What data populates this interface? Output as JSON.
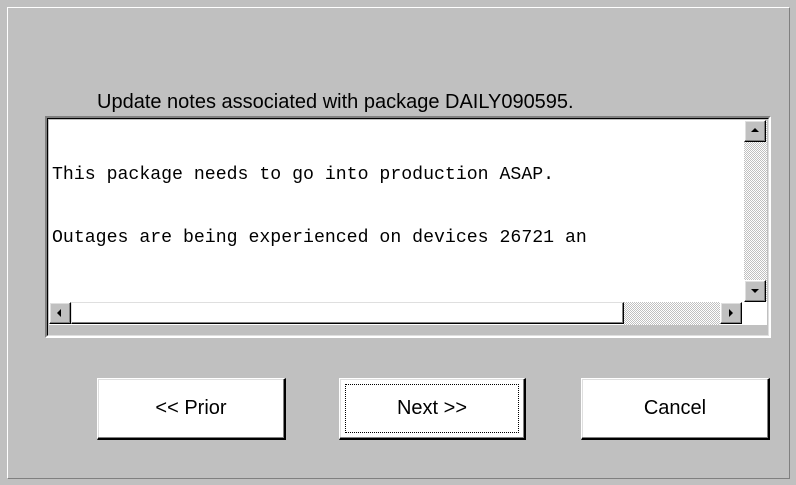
{
  "dialog": {
    "instruction": "Update notes associated with package DAILY090595.",
    "notes": {
      "lines": [
        "This package needs to go into production ASAP.",
        "Outages are being experienced on devices 26721 an"
      ]
    },
    "buttons": {
      "prior_label": "<< Prior",
      "next_label": "Next >>",
      "cancel_label": "Cancel"
    },
    "focused_button": "next"
  },
  "icons": {
    "scroll_up": "arrow-up-icon",
    "scroll_down": "arrow-down-icon",
    "scroll_left": "arrow-left-icon",
    "scroll_right": "arrow-right-icon"
  },
  "colors": {
    "dialog_background": "#c0c0c0",
    "text_area_background": "#ffffff",
    "button_face": "#ffffff"
  }
}
